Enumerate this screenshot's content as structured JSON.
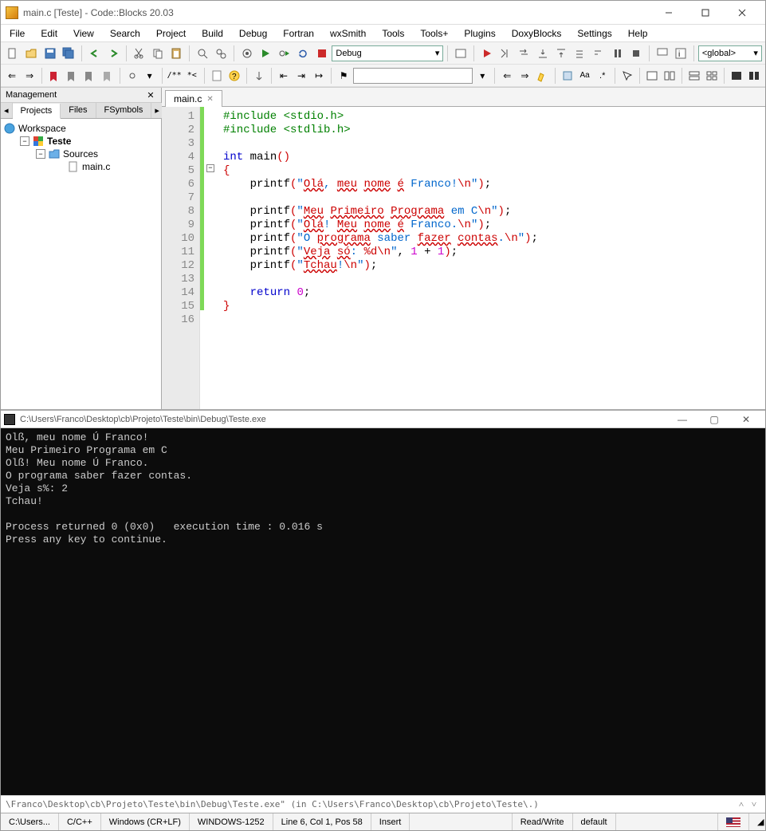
{
  "window": {
    "title": "main.c [Teste] - Code::Blocks 20.03"
  },
  "menu": {
    "items": [
      "File",
      "Edit",
      "View",
      "Search",
      "Project",
      "Build",
      "Debug",
      "Fortran",
      "wxSmith",
      "Tools",
      "Tools+",
      "Plugins",
      "DoxyBlocks",
      "Settings",
      "Help"
    ]
  },
  "toolbar": {
    "build_target": "Debug",
    "scope": "<global>",
    "search_value": ""
  },
  "sidebar": {
    "title": "Management",
    "tabs": [
      "Projects",
      "Files",
      "FSymbols"
    ],
    "tree": {
      "workspace": "Workspace",
      "project": "Teste",
      "folder": "Sources",
      "file": "main.c"
    }
  },
  "editor": {
    "tab_label": "main.c",
    "lines": [
      {
        "n": 1,
        "change": true,
        "html": "<span class='pp'>#include &lt;stdio.h&gt;</span>"
      },
      {
        "n": 2,
        "change": true,
        "html": "<span class='pp'>#include &lt;stdlib.h&gt;</span>"
      },
      {
        "n": 3,
        "change": true,
        "html": ""
      },
      {
        "n": 4,
        "change": true,
        "html": "<span class='kw'>int</span> main<span class='pa'>()</span>"
      },
      {
        "n": 5,
        "change": true,
        "fold": true,
        "html": "<span class='pa'>{</span>"
      },
      {
        "n": 6,
        "change": true,
        "html": "    printf<span class='pa'>(</span><span class='st'>\"</span><span class='sq'>Olá</span><span class='st'>, </span><span class='sq'>meu</span><span class='st'> </span><span class='sq'>nome</span><span class='st'> </span><span class='sq'>é</span><span class='st'> Franco!</span><span class='op'>\\n</span><span class='st'>\"</span><span class='pa'>)</span>;"
      },
      {
        "n": 7,
        "change": true,
        "html": ""
      },
      {
        "n": 8,
        "change": true,
        "html": "    printf<span class='pa'>(</span><span class='st'>\"</span><span class='sq'>Meu</span><span class='st'> </span><span class='sq'>Primeiro</span><span class='st'> </span><span class='sq'>Programa</span><span class='st'> em C</span><span class='op'>\\n</span><span class='st'>\"</span><span class='pa'>)</span>;"
      },
      {
        "n": 9,
        "change": true,
        "html": "    printf<span class='pa'>(</span><span class='st'>\"</span><span class='sq'>Olá</span><span class='st'>! </span><span class='sq'>Meu</span><span class='st'> </span><span class='sq'>nome</span><span class='st'> </span><span class='sq'>é</span><span class='st'> Franco.</span><span class='op'>\\n</span><span class='st'>\"</span><span class='pa'>)</span>;"
      },
      {
        "n": 10,
        "change": true,
        "html": "    printf<span class='pa'>(</span><span class='st'>\"O </span><span class='sq'>programa</span><span class='st'> saber </span><span class='sq'>fazer</span><span class='st'> </span><span class='sq'>contas</span><span class='st'>.</span><span class='op'>\\n</span><span class='st'>\"</span><span class='pa'>)</span>;"
      },
      {
        "n": 11,
        "change": true,
        "html": "    printf<span class='pa'>(</span><span class='st'>\"</span><span class='sq'>Veja</span><span class='st'> </span><span class='sq'>só</span><span class='st'>: </span><span class='op'>%d\\n</span><span class='st'>\"</span>, <span class='nu'>1</span> + <span class='nu'>1</span><span class='pa'>)</span>;"
      },
      {
        "n": 12,
        "change": true,
        "html": "    printf<span class='pa'>(</span><span class='st'>\"</span><span class='sq'>Tchau</span><span class='st'>!</span><span class='op'>\\n</span><span class='st'>\"</span><span class='pa'>)</span>;"
      },
      {
        "n": 13,
        "change": true,
        "html": ""
      },
      {
        "n": 14,
        "change": true,
        "html": "    <span class='kw'>return</span> <span class='nu'>0</span>;"
      },
      {
        "n": 15,
        "change": true,
        "html": "<span class='pa'>}</span>"
      },
      {
        "n": 16,
        "change": false,
        "html": ""
      }
    ]
  },
  "console": {
    "title": "C:\\Users\\Franco\\Desktop\\cb\\Projeto\\Teste\\bin\\Debug\\Teste.exe",
    "output": "Olß, meu nome Ú Franco!\nMeu Primeiro Programa em C\nOlß! Meu nome Ú Franco.\nO programa saber fazer contas.\nVeja s%: 2\nTchau!\n\nProcess returned 0 (0x0)   execution time : 0.016 s\nPress any key to continue."
  },
  "log_snippet": "\\Franco\\Desktop\\cb\\Projeto\\Teste\\bin\\Debug\\Teste.exe\"  (in C:\\Users\\Franco\\Desktop\\cb\\Projeto\\Teste\\.)",
  "statusbar": {
    "path": "C:\\Users...",
    "lang": "C/C++",
    "eol": "Windows (CR+LF)",
    "encoding": "WINDOWS-1252",
    "pos": "Line 6, Col 1, Pos 58",
    "mode": "Insert",
    "rw": "Read/Write",
    "profile": "default"
  }
}
